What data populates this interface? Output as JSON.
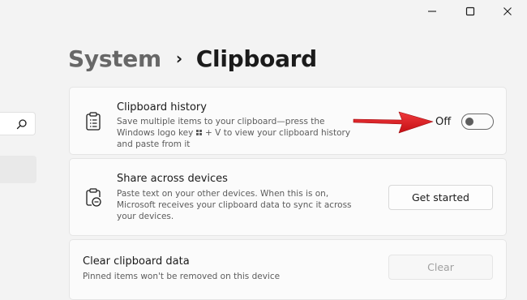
{
  "window": {
    "controls": [
      "minimize-icon",
      "maximize-icon",
      "close-icon"
    ]
  },
  "header": {
    "parent": "System",
    "separator": "›",
    "current": "Clipboard"
  },
  "sidebar": {
    "search_icon": "search-icon"
  },
  "clipboard_history": {
    "icon": "clipboard-list-icon",
    "title": "Clipboard history",
    "desc_part1": "Save multiple items to your clipboard—press the Windows logo key",
    "desc_part2": "+ V to view your clipboard history and paste from it",
    "toggle_state": "Off",
    "toggle_on": false
  },
  "share_devices": {
    "icon": "clipboard-sync-icon",
    "title": "Share across devices",
    "desc": "Paste text on your other devices. When this is on, Microsoft receives your clipboard data to sync it across your devices.",
    "button": "Get started"
  },
  "clear_data": {
    "title": "Clear clipboard data",
    "desc": "Pinned items won't be removed on this device",
    "button": "Clear",
    "button_enabled": false
  },
  "colors": {
    "background": "#f3f3f3",
    "card": "#fbfbfb",
    "annotation_arrow": "#e0161b"
  }
}
